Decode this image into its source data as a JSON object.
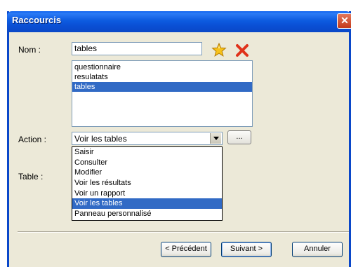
{
  "window": {
    "title": "Raccourcis",
    "close_glyph": "✕"
  },
  "form": {
    "name_label": "Nom :",
    "name_value": "tables",
    "action_label": "Action :",
    "table_label": "Table :"
  },
  "shortcuts_list": {
    "items": [
      "questionnaire",
      "resulatats",
      "tables"
    ],
    "selected_index": 2
  },
  "action_combo": {
    "selected_value": "Voir les tables",
    "browse_button_label": "...",
    "options": [
      "Saisir",
      "Consulter",
      "Modifier",
      "Voir les résultats",
      "Voir un rapport",
      "Voir les tables",
      "Panneau personnalisé"
    ],
    "highlighted_index": 5
  },
  "icons": {
    "favorite": "star-icon",
    "delete": "delete-x-icon",
    "dropdown_arrow": "chevron-down-icon"
  },
  "buttons": {
    "previous": "< Précédent",
    "next": "Suivant >",
    "cancel": "Annuler"
  },
  "colors": {
    "titlebar": "#0A4FD4",
    "selection": "#316AC5",
    "dialog_bg": "#ECE9D8",
    "delete_red": "#E0321A",
    "star_yellow": "#F7C21A"
  }
}
